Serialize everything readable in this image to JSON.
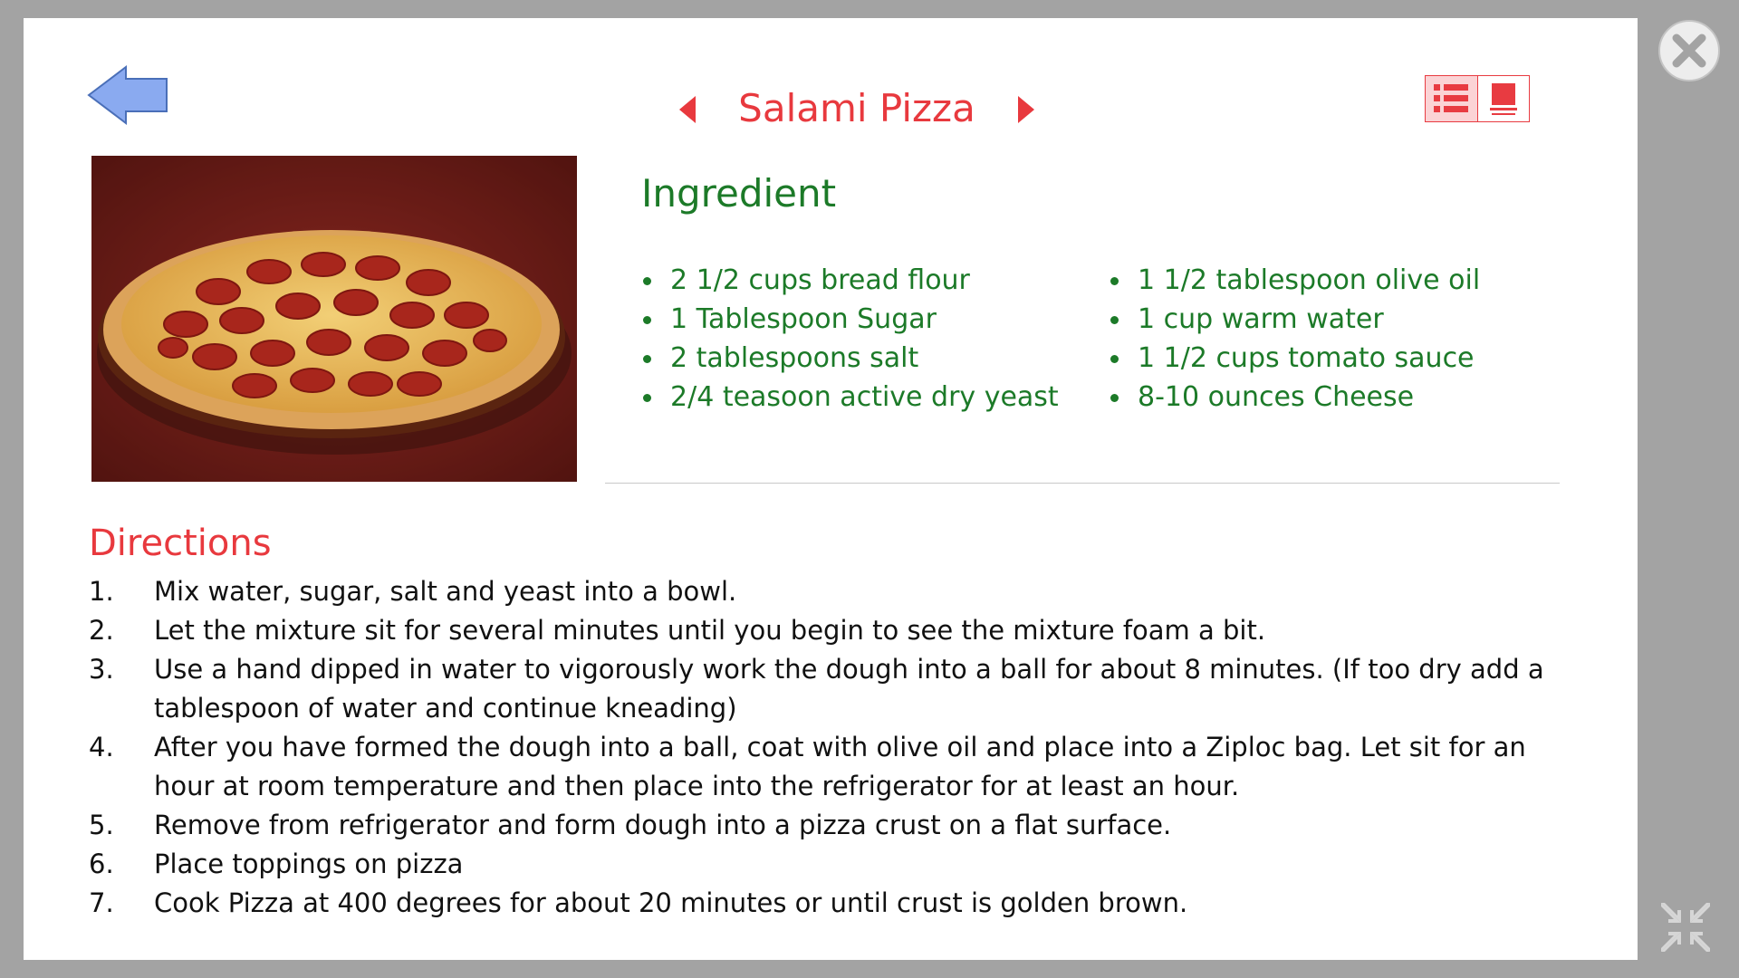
{
  "recipe": {
    "title": "Salami Pizza"
  },
  "ingredients": {
    "heading": "Ingredient",
    "left": [
      "2 1/2 cups bread flour",
      "1 Tablespoon Sugar",
      "2 tablespoons salt",
      "2/4 teasoon active dry yeast"
    ],
    "right": [
      "1 1/2 tablespoon olive oil",
      "1 cup warm water",
      "1 1/2 cups tomato sauce",
      "8-10 ounces Cheese"
    ]
  },
  "directions": {
    "heading": "Directions",
    "steps": [
      {
        "num": "1.",
        "text": "Mix water, sugar, salt and yeast into a bowl."
      },
      {
        "num": "2.",
        "text": "Let the mixture sit for several minutes until you begin to see the mixture foam a bit."
      },
      {
        "num": "3.",
        "text": "Use a hand dipped in water to vigorously work the dough into a ball for about 8 minutes.  (If too dry add a tablespoon of water and continue kneading)"
      },
      {
        "num": "4.",
        "text": "After you have formed the dough into a ball, coat with olive oil and place into a Ziploc bag. Let sit for an hour at room temperature and then place into the refrigerator for at least an hour."
      },
      {
        "num": "5.",
        "text": "Remove from refrigerator and form dough into a pizza crust on a flat surface."
      },
      {
        "num": "6.",
        "text": "Place toppings on pizza"
      },
      {
        "num": "7.",
        "text": "Cook Pizza at 400 degrees for about 20 minutes or until crust is golden brown."
      }
    ]
  },
  "colors": {
    "accent_red": "#e8393e",
    "ingredient_green": "#1c7a28",
    "back_arrow_blue": "#8aaaf0",
    "frame_gray": "#a3a3a3"
  },
  "icons": {
    "back": "left-arrow-icon",
    "prev": "triangle-left-icon",
    "next": "triangle-right-icon",
    "list_view": "list-view-icon",
    "page_view": "page-view-icon",
    "close": "close-icon",
    "fullscreen": "exit-fullscreen-icon"
  }
}
